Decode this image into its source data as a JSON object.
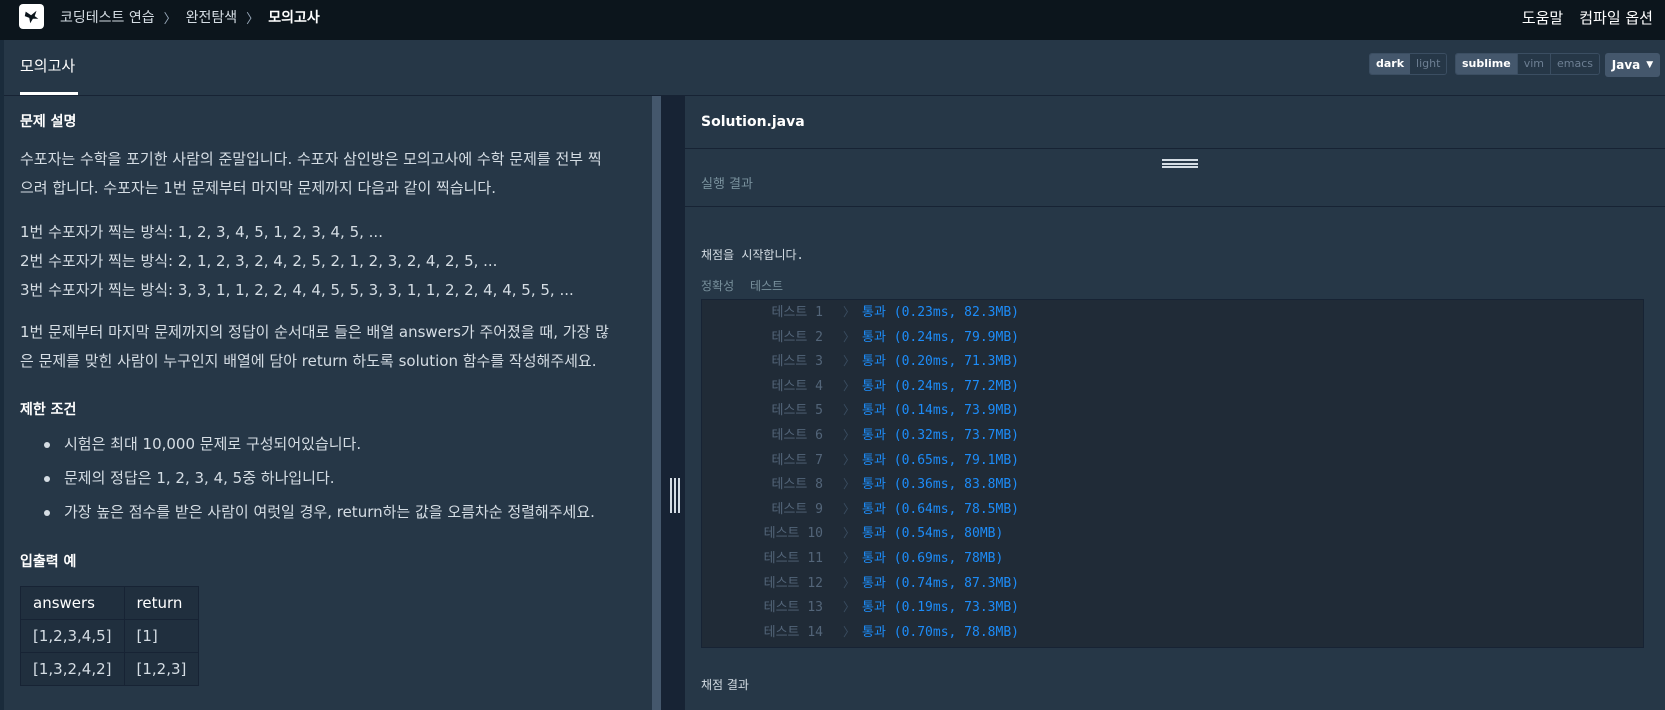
{
  "nav": {
    "breadcrumbs": [
      "코딩테스트 연습",
      "완전탐색",
      "모의고사"
    ],
    "right_links": [
      "도움말",
      "컴파일 옵션"
    ]
  },
  "tab": {
    "label": "모의고사"
  },
  "theme_toggle": [
    "dark",
    "light"
  ],
  "editor_toggle": [
    "sublime",
    "vim",
    "emacs"
  ],
  "language": "Java",
  "problem": {
    "desc_title": "문제 설명",
    "desc_lines": [
      "수포자는 수학을 포기한 사람의 준말입니다. 수포자 삼인방은 모의고사에 수학 문제를 전부 찍",
      "으려 합니다. 수포자는 1번 문제부터 마지막 문제까지 다음과 같이 찍습니다."
    ],
    "patterns": [
      "1번 수포자가 찍는 방식: 1, 2, 3, 4, 5, 1, 2, 3, 4, 5, ...",
      "2번 수포자가 찍는 방식: 2, 1, 2, 3, 2, 4, 2, 5, 2, 1, 2, 3, 2, 4, 2, 5, ...",
      "3번 수포자가 찍는 방식: 3, 3, 1, 1, 2, 2, 4, 4, 5, 5, 3, 3, 1, 1, 2, 2, 4, 4, 5, 5, ..."
    ],
    "task_lines": [
      "1번 문제부터 마지막 문제까지의 정답이 순서대로 들은 배열 answers가 주어졌을 때, 가장 많",
      "은 문제를 맞힌 사람이 누구인지 배열에 담아 return 하도록 solution 함수를 작성해주세요."
    ],
    "constraints_title": "제한 조건",
    "constraints": [
      "시험은 최대 10,000 문제로 구성되어있습니다.",
      "문제의 정답은 1, 2, 3, 4, 5중 하나입니다.",
      "가장 높은 점수를 받은 사람이 여럿일 경우, return하는 값을 오름차순 정렬해주세요."
    ],
    "examples_title": "입출력 예",
    "table": {
      "headers": [
        "answers",
        "return"
      ],
      "rows": [
        [
          "[1,2,3,4,5]",
          "[1]"
        ],
        [
          "[1,3,2,4,2]",
          "[1,2,3]"
        ]
      ]
    }
  },
  "editor": {
    "filename": "Solution.java",
    "result_title": "실행 결과",
    "start_msg": "채점을 시작합니다.",
    "sub_labels": [
      "정확성",
      "테스트"
    ],
    "tests": [
      {
        "label": "테스트 1",
        "result": "통과 (0.23ms, 82.3MB)"
      },
      {
        "label": "테스트 2",
        "result": "통과 (0.24ms, 79.9MB)"
      },
      {
        "label": "테스트 3",
        "result": "통과 (0.20ms, 71.3MB)"
      },
      {
        "label": "테스트 4",
        "result": "통과 (0.24ms, 77.2MB)"
      },
      {
        "label": "테스트 5",
        "result": "통과 (0.14ms, 73.9MB)"
      },
      {
        "label": "테스트 6",
        "result": "통과 (0.32ms, 73.7MB)"
      },
      {
        "label": "테스트 7",
        "result": "통과 (0.65ms, 79.1MB)"
      },
      {
        "label": "테스트 8",
        "result": "통과 (0.36ms, 83.8MB)"
      },
      {
        "label": "테스트 9",
        "result": "통과 (0.64ms, 78.5MB)"
      },
      {
        "label": "테스트 10",
        "result": "통과 (0.54ms, 80MB)"
      },
      {
        "label": "테스트 11",
        "result": "통과 (0.69ms, 78MB)"
      },
      {
        "label": "테스트 12",
        "result": "통과 (0.74ms, 87.3MB)"
      },
      {
        "label": "테스트 13",
        "result": "통과 (0.19ms, 73.3MB)"
      },
      {
        "label": "테스트 14",
        "result": "통과 (0.70ms, 78.8MB)"
      }
    ],
    "footer": "채점 결과"
  }
}
